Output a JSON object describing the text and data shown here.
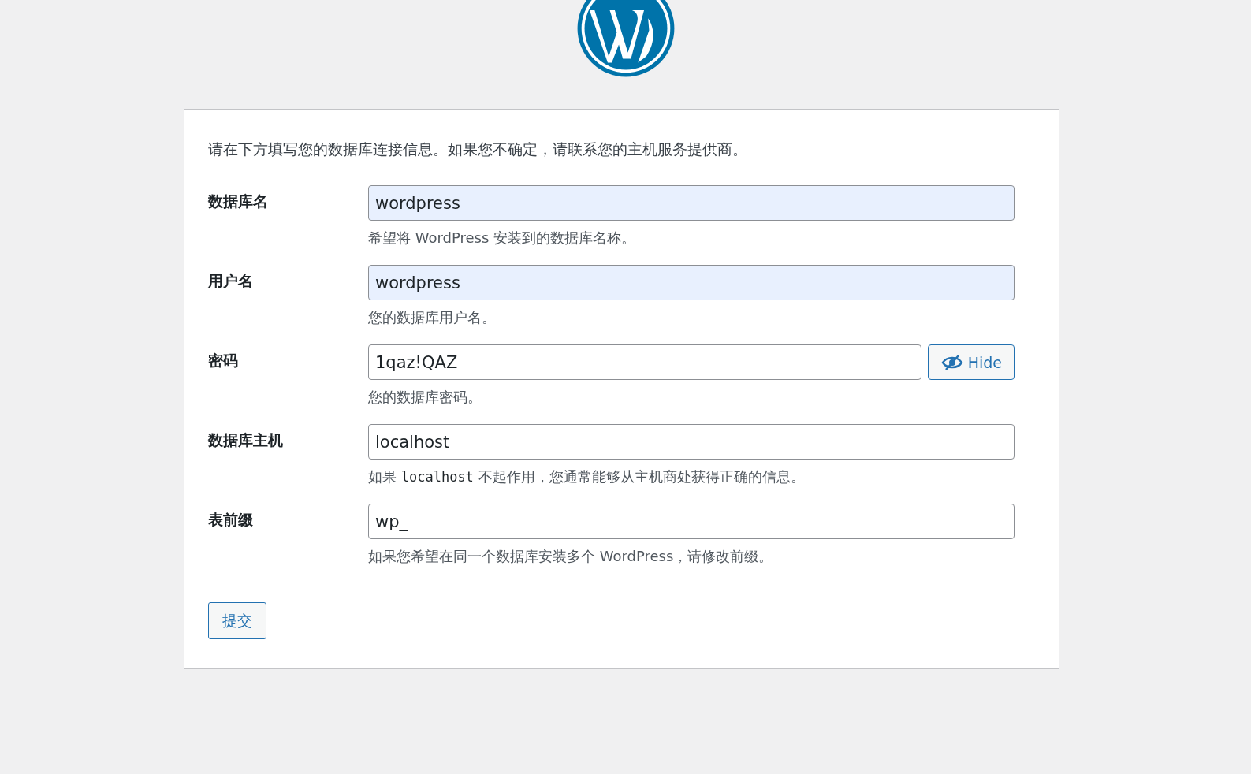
{
  "intro": "请在下方填写您的数据库连接信息。如果您不确定，请联系您的主机服务提供商。",
  "fields": [
    {
      "label": "数据库名",
      "value": "wordpress",
      "autofilled": true,
      "description": [
        {
          "kind": "text",
          "text": "希望将 WordPress 安装到的数据库名称。"
        }
      ]
    },
    {
      "label": "用户名",
      "value": "wordpress",
      "autofilled": true,
      "description": [
        {
          "kind": "text",
          "text": "您的数据库用户名。"
        }
      ]
    },
    {
      "label": "密码",
      "value": "1qaz!QAZ",
      "autofilled": false,
      "toggle": "Hide",
      "description": [
        {
          "kind": "text",
          "text": "您的数据库密码。"
        }
      ]
    },
    {
      "label": "数据库主机",
      "value": "localhost",
      "autofilled": false,
      "description": [
        {
          "kind": "text",
          "text": "如果 "
        },
        {
          "kind": "code",
          "text": "localhost"
        },
        {
          "kind": "text",
          "text": " 不起作用，您通常能够从主机商处获得正确的信息。"
        }
      ]
    },
    {
      "label": "表前缀",
      "value": "wp_",
      "autofilled": false,
      "description": [
        {
          "kind": "text",
          "text": "如果您希望在同一个数据库安装多个 WordPress，请修改前缀。"
        }
      ]
    }
  ],
  "submit": "提交"
}
